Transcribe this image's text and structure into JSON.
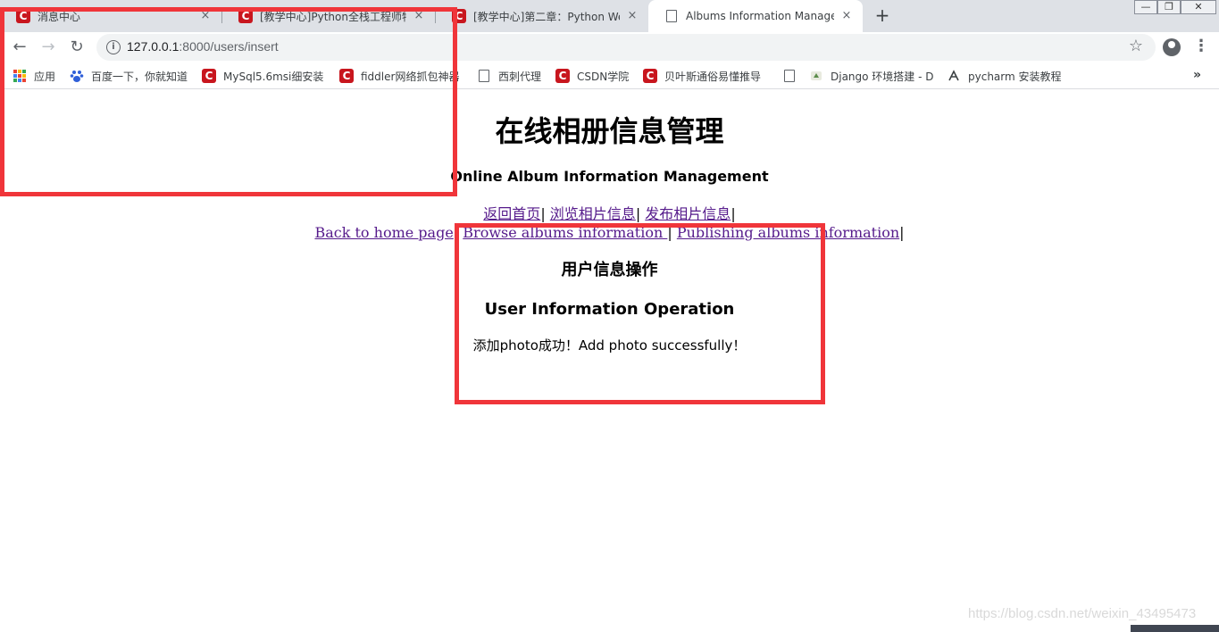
{
  "browser": {
    "tabs": [
      {
        "title": "消息中心",
        "favicon": "csdn-logo-icon",
        "active": false
      },
      {
        "title": "[教学中心]Python全栈工程师特训",
        "favicon": "csdn-logo-icon",
        "active": false
      },
      {
        "title": "[教学中心]第二章：Python Web",
        "favicon": "csdn-logo-icon",
        "active": false
      },
      {
        "title": "Albums Information Management",
        "favicon": "document-icon",
        "active": true
      }
    ],
    "new_tab_label": "+",
    "close_glyph": "×",
    "window_controls": {
      "minimize": "—",
      "restore": "❐",
      "close": "✕"
    },
    "nav": {
      "back": "←",
      "forward": "→",
      "reload": "↻"
    },
    "url": {
      "host": "127.0.0.1",
      "path": ":8000/users/insert"
    },
    "bookmarks": [
      {
        "label": "应用",
        "icon": "apps-grid-icon"
      },
      {
        "label": "百度一下，你就知道",
        "icon": "baidu-paw-icon"
      },
      {
        "label": "MySql5.6msi细安装",
        "icon": "csdn-logo-icon"
      },
      {
        "label": "fiddler网络抓包神器",
        "icon": "csdn-logo-icon"
      },
      {
        "label": "西刺代理",
        "icon": "document-icon"
      },
      {
        "label": "CSDN学院",
        "icon": "csdn-logo-icon"
      },
      {
        "label": "贝叶斯通俗易懂推导",
        "icon": "csdn-logo-icon"
      },
      {
        "label": "",
        "icon": "document-icon"
      },
      {
        "label": "Django 环境搭建 - D",
        "icon": "django-favicon-icon"
      },
      {
        "label": "pycharm 安装教程",
        "icon": "pycharm-favicon-icon"
      }
    ],
    "bookmarks_overflow": "»"
  },
  "page": {
    "title_cn": "在线相册信息管理",
    "title_en": "Online Album Information Management",
    "nav_cn": [
      {
        "label": "返回首页",
        "sep": "|"
      },
      {
        "label": "浏览相片信息",
        "sep": "|"
      },
      {
        "label": "发布相片信息",
        "sep": "|"
      }
    ],
    "nav_en": [
      {
        "label": "Back to home page",
        "sep": "|"
      },
      {
        "label": "Browse albums information ",
        "sep": "|"
      },
      {
        "label": "Publishing albums information",
        "sep": "|"
      }
    ],
    "section_cn": "用户信息操作",
    "section_en": "User Information Operation",
    "message": "添加photo成功！Add photo successfully！"
  },
  "watermark": "https://blog.csdn.net/weixin_43495473",
  "colors": {
    "annotation_red": "#f0353a",
    "visited_link": "#551a8b",
    "csdn_red": "#c8161e",
    "tabstrip_bg": "#dee1e6"
  }
}
